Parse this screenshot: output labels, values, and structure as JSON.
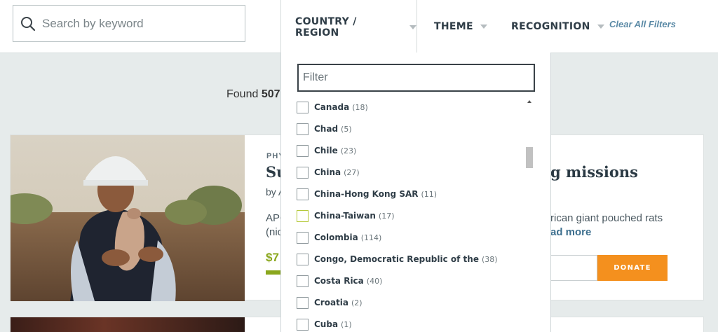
{
  "search": {
    "placeholder": "Search by keyword"
  },
  "filters": {
    "country_label": "COUNTRY / REGION",
    "theme_label": "THEME",
    "recognition_label": "RECOGNITION",
    "clear_all": "Clear All Filters"
  },
  "results": {
    "found_prefix": "Found",
    "found_count": "507"
  },
  "card": {
    "kicker": "PHY",
    "title_start": "Su",
    "title_end": "g missions",
    "by": "by A",
    "desc_line1": "APO",
    "desc_line2": "(nic",
    "desc_end": "rican giant pouched rats",
    "read_more": "ad more",
    "amount": "$7",
    "progress_fraction": 0.1,
    "donate": "DONATE"
  },
  "country_dropdown": {
    "filter_placeholder": "Filter",
    "options": [
      {
        "label": "Canada",
        "count": "(18)"
      },
      {
        "label": "Chad",
        "count": "(5)"
      },
      {
        "label": "Chile",
        "count": "(23)"
      },
      {
        "label": "China",
        "count": "(27)"
      },
      {
        "label": "China-Hong Kong SAR",
        "count": "(11)"
      },
      {
        "label": "China-Taiwan",
        "count": "(17)"
      },
      {
        "label": "Colombia",
        "count": "(114)"
      },
      {
        "label": "Congo, Democratic Republic of the",
        "count": "(38)"
      },
      {
        "label": "Costa Rica",
        "count": "(40)"
      },
      {
        "label": "Croatia",
        "count": "(2)"
      },
      {
        "label": "Cuba",
        "count": "(1)"
      }
    ]
  },
  "colors": {
    "accent_orange": "#f4901e",
    "progress_green": "#8aa71d",
    "link_blue": "#5b8aa6",
    "page_bg": "#e6ebeb"
  }
}
